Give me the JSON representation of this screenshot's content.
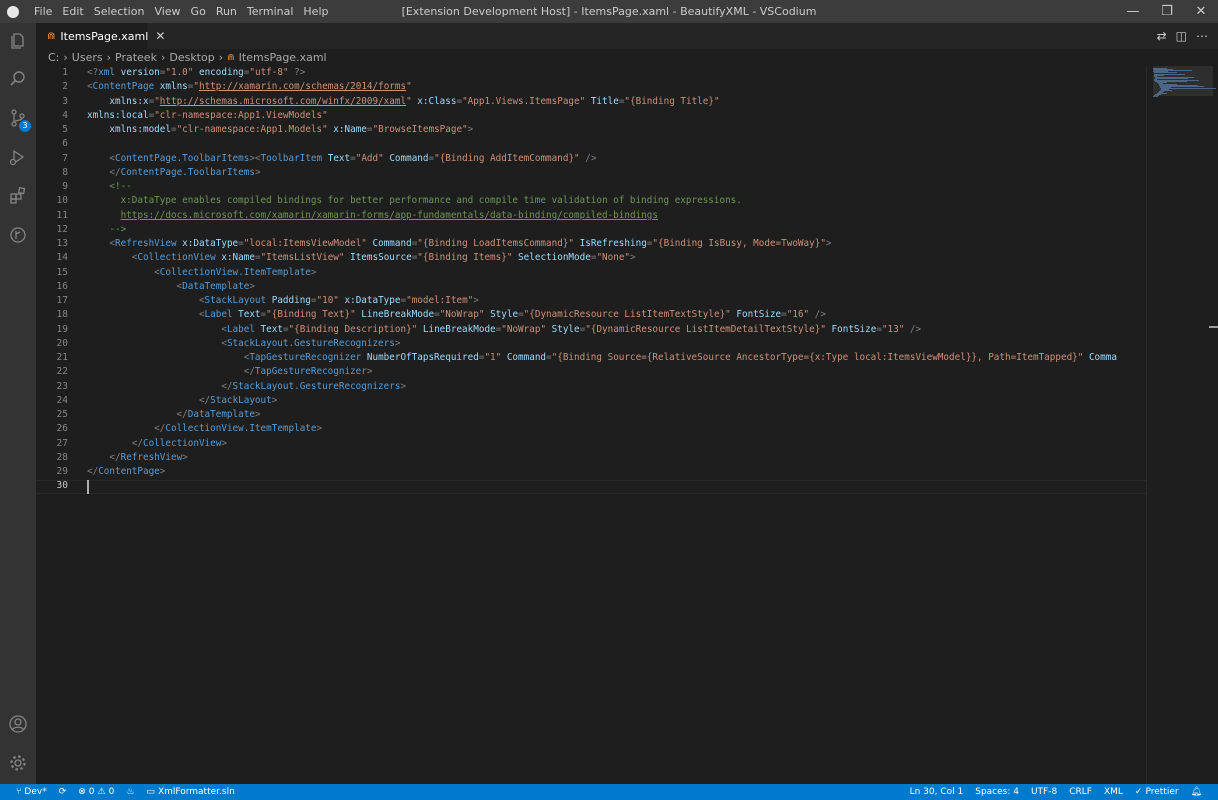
{
  "titlebar": {
    "menus": [
      "File",
      "Edit",
      "Selection",
      "View",
      "Go",
      "Run",
      "Terminal",
      "Help"
    ],
    "title": "[Extension Development Host] - ItemsPage.xaml - BeautifyXML - VSCodium"
  },
  "activity": {
    "icons": [
      "explorer-icon",
      "search-icon",
      "source-control-icon",
      "run-debug-icon",
      "extensions-icon",
      "remote-icon",
      "account-icon",
      "gear-icon"
    ],
    "scm_badge": "3"
  },
  "tab": {
    "label": "ItemsPage.xaml",
    "icon_glyph": "⋒",
    "close_glyph": "✕"
  },
  "breadcrumb": [
    "C:",
    "Users",
    "Prateek",
    "Desktop",
    "ItemsPage.xaml"
  ],
  "editor": {
    "active_line": 30,
    "lines": [
      [
        [
          "p",
          "<?"
        ],
        [
          "t",
          "xml "
        ],
        [
          "a",
          "version"
        ],
        [
          "p",
          "="
        ],
        [
          "s",
          "\"1.0\""
        ],
        [
          "a",
          " encoding"
        ],
        [
          "p",
          "="
        ],
        [
          "s",
          "\"utf-8\""
        ],
        [
          "p",
          " ?>"
        ]
      ],
      [
        [
          "p",
          "<"
        ],
        [
          "t",
          "ContentPage "
        ],
        [
          "a",
          "xmlns"
        ],
        [
          "p",
          "="
        ],
        [
          "s",
          "\""
        ],
        [
          "u",
          "http://xamarin.com/schemas/2014/forms"
        ],
        [
          "s",
          "\""
        ]
      ],
      [
        [
          "a",
          "    xmlns:x"
        ],
        [
          "p",
          "="
        ],
        [
          "s",
          "\""
        ],
        [
          "u",
          "http://schemas.microsoft.com/winfx/2009/xaml"
        ],
        [
          "s",
          "\""
        ],
        [
          "a",
          " x:Class"
        ],
        [
          "p",
          "="
        ],
        [
          "s",
          "\"App1.Views.ItemsPage\""
        ],
        [
          "a",
          " Title"
        ],
        [
          "p",
          "="
        ],
        [
          "s",
          "\"{Binding Title}\""
        ]
      ],
      [
        [
          "a",
          "xmlns:local"
        ],
        [
          "p",
          "="
        ],
        [
          "s",
          "\"clr-namespace:App1.ViewModels\""
        ]
      ],
      [
        [
          "a",
          "    xmlns:model"
        ],
        [
          "p",
          "="
        ],
        [
          "s",
          "\"clr-namespace:App1.Models\""
        ],
        [
          "a",
          " x:Name"
        ],
        [
          "p",
          "="
        ],
        [
          "s",
          "\"BrowseItemsPage\""
        ],
        [
          "p",
          ">"
        ]
      ],
      [],
      [
        [
          "p",
          "    <"
        ],
        [
          "t",
          "ContentPage.ToolbarItems"
        ],
        [
          "p",
          "><"
        ],
        [
          "t",
          "ToolbarItem "
        ],
        [
          "a",
          "Text"
        ],
        [
          "p",
          "="
        ],
        [
          "s",
          "\"Add\""
        ],
        [
          "a",
          " Command"
        ],
        [
          "p",
          "="
        ],
        [
          "s",
          "\"{Binding AddItemCommand}\""
        ],
        [
          "p",
          " />"
        ]
      ],
      [
        [
          "p",
          "    </"
        ],
        [
          "t",
          "ContentPage.ToolbarItems"
        ],
        [
          "p",
          ">"
        ]
      ],
      [
        [
          "c",
          "    <!--"
        ]
      ],
      [
        [
          "c",
          "      x:DataType enables compiled bindings for better performance and compile time validation of binding expressions."
        ]
      ],
      [
        [
          "c",
          "      "
        ],
        [
          "l",
          "https://docs.microsoft.com/xamarin/xamarin-forms/app-fundamentals/data-binding/compiled-bindings"
        ]
      ],
      [
        [
          "c",
          "    -->"
        ]
      ],
      [
        [
          "p",
          "    <"
        ],
        [
          "t",
          "RefreshView "
        ],
        [
          "a",
          "x:DataType"
        ],
        [
          "p",
          "="
        ],
        [
          "s",
          "\"local:ItemsViewModel\""
        ],
        [
          "a",
          " Command"
        ],
        [
          "p",
          "="
        ],
        [
          "s",
          "\"{Binding LoadItemsCommand}\""
        ],
        [
          "a",
          " IsRefreshing"
        ],
        [
          "p",
          "="
        ],
        [
          "s",
          "\"{Binding IsBusy, Mode=TwoWay}\""
        ],
        [
          "p",
          ">"
        ]
      ],
      [
        [
          "p",
          "        <"
        ],
        [
          "t",
          "CollectionView "
        ],
        [
          "a",
          "x:Name"
        ],
        [
          "p",
          "="
        ],
        [
          "s",
          "\"ItemsListView\""
        ],
        [
          "a",
          " ItemsSource"
        ],
        [
          "p",
          "="
        ],
        [
          "s",
          "\"{Binding Items}\""
        ],
        [
          "a",
          " SelectionMode"
        ],
        [
          "p",
          "="
        ],
        [
          "s",
          "\"None\""
        ],
        [
          "p",
          ">"
        ]
      ],
      [
        [
          "p",
          "            <"
        ],
        [
          "t",
          "CollectionView.ItemTemplate"
        ],
        [
          "p",
          ">"
        ]
      ],
      [
        [
          "p",
          "                <"
        ],
        [
          "t",
          "DataTemplate"
        ],
        [
          "p",
          ">"
        ]
      ],
      [
        [
          "p",
          "                    <"
        ],
        [
          "t",
          "StackLayout "
        ],
        [
          "a",
          "Padding"
        ],
        [
          "p",
          "="
        ],
        [
          "s",
          "\"10\""
        ],
        [
          "a",
          " x:DataType"
        ],
        [
          "p",
          "="
        ],
        [
          "s",
          "\"model:Item\""
        ],
        [
          "p",
          ">"
        ]
      ],
      [
        [
          "p",
          "                    <"
        ],
        [
          "t",
          "Label "
        ],
        [
          "a",
          "Text"
        ],
        [
          "p",
          "="
        ],
        [
          "s",
          "\"{Binding Text}\""
        ],
        [
          "a",
          " LineBreakMode"
        ],
        [
          "p",
          "="
        ],
        [
          "s",
          "\"NoWrap\""
        ],
        [
          "a",
          " Style"
        ],
        [
          "p",
          "="
        ],
        [
          "s",
          "\"{DynamicResource ListItemTextStyle}\""
        ],
        [
          "a",
          " FontSize"
        ],
        [
          "p",
          "="
        ],
        [
          "s",
          "\"16\""
        ],
        [
          "p",
          " />"
        ]
      ],
      [
        [
          "p",
          "                        <"
        ],
        [
          "t",
          "Label "
        ],
        [
          "a",
          "Text"
        ],
        [
          "p",
          "="
        ],
        [
          "s",
          "\"{Binding Description}\""
        ],
        [
          "a",
          " LineBreakMode"
        ],
        [
          "p",
          "="
        ],
        [
          "s",
          "\"NoWrap\""
        ],
        [
          "a",
          " Style"
        ],
        [
          "p",
          "="
        ],
        [
          "s",
          "\"{DynamicResource ListItemDetailTextStyle}\""
        ],
        [
          "a",
          " FontSize"
        ],
        [
          "p",
          "="
        ],
        [
          "s",
          "\"13\""
        ],
        [
          "p",
          " />"
        ]
      ],
      [
        [
          "p",
          "                        <"
        ],
        [
          "t",
          "StackLayout.GestureRecognizers"
        ],
        [
          "p",
          ">"
        ]
      ],
      [
        [
          "p",
          "                            <"
        ],
        [
          "t",
          "TapGestureRecognizer "
        ],
        [
          "a",
          "NumberOfTapsRequired"
        ],
        [
          "p",
          "="
        ],
        [
          "s",
          "\"1\""
        ],
        [
          "a",
          " Command"
        ],
        [
          "p",
          "="
        ],
        [
          "s",
          "\"{Binding Source={RelativeSource AncestorType={x:Type local:ItemsViewModel}}, Path=ItemTapped}\""
        ],
        [
          "a",
          " Comma"
        ]
      ],
      [
        [
          "p",
          "                            </"
        ],
        [
          "t",
          "TapGestureRecognizer"
        ],
        [
          "p",
          ">"
        ]
      ],
      [
        [
          "p",
          "                        </"
        ],
        [
          "t",
          "StackLayout.GestureRecognizers"
        ],
        [
          "p",
          ">"
        ]
      ],
      [
        [
          "p",
          "                    </"
        ],
        [
          "t",
          "StackLayout"
        ],
        [
          "p",
          ">"
        ]
      ],
      [
        [
          "p",
          "                </"
        ],
        [
          "t",
          "DataTemplate"
        ],
        [
          "p",
          ">"
        ]
      ],
      [
        [
          "p",
          "            </"
        ],
        [
          "t",
          "CollectionView.ItemTemplate"
        ],
        [
          "p",
          ">"
        ]
      ],
      [
        [
          "p",
          "        </"
        ],
        [
          "t",
          "CollectionView"
        ],
        [
          "p",
          ">"
        ]
      ],
      [
        [
          "p",
          "    </"
        ],
        [
          "t",
          "RefreshView"
        ],
        [
          "p",
          ">"
        ]
      ],
      [
        [
          "p",
          "</"
        ],
        [
          "t",
          "ContentPage"
        ],
        [
          "p",
          ">"
        ]
      ],
      []
    ]
  },
  "statusbar": {
    "branch": "Dev*",
    "errors": "0",
    "warnings": "0",
    "solution": "XmlFormatter.sln",
    "position": "Ln 30, Col 1",
    "spaces": "Spaces: 4",
    "encoding": "UTF-8",
    "eol": "CRLF",
    "language": "XML",
    "formatter": "Prettier"
  },
  "colors": {
    "accent": "#007acc",
    "tag": "#569cd6",
    "attr": "#9cdcfe",
    "string": "#ce9178",
    "comment": "#6a9955"
  }
}
